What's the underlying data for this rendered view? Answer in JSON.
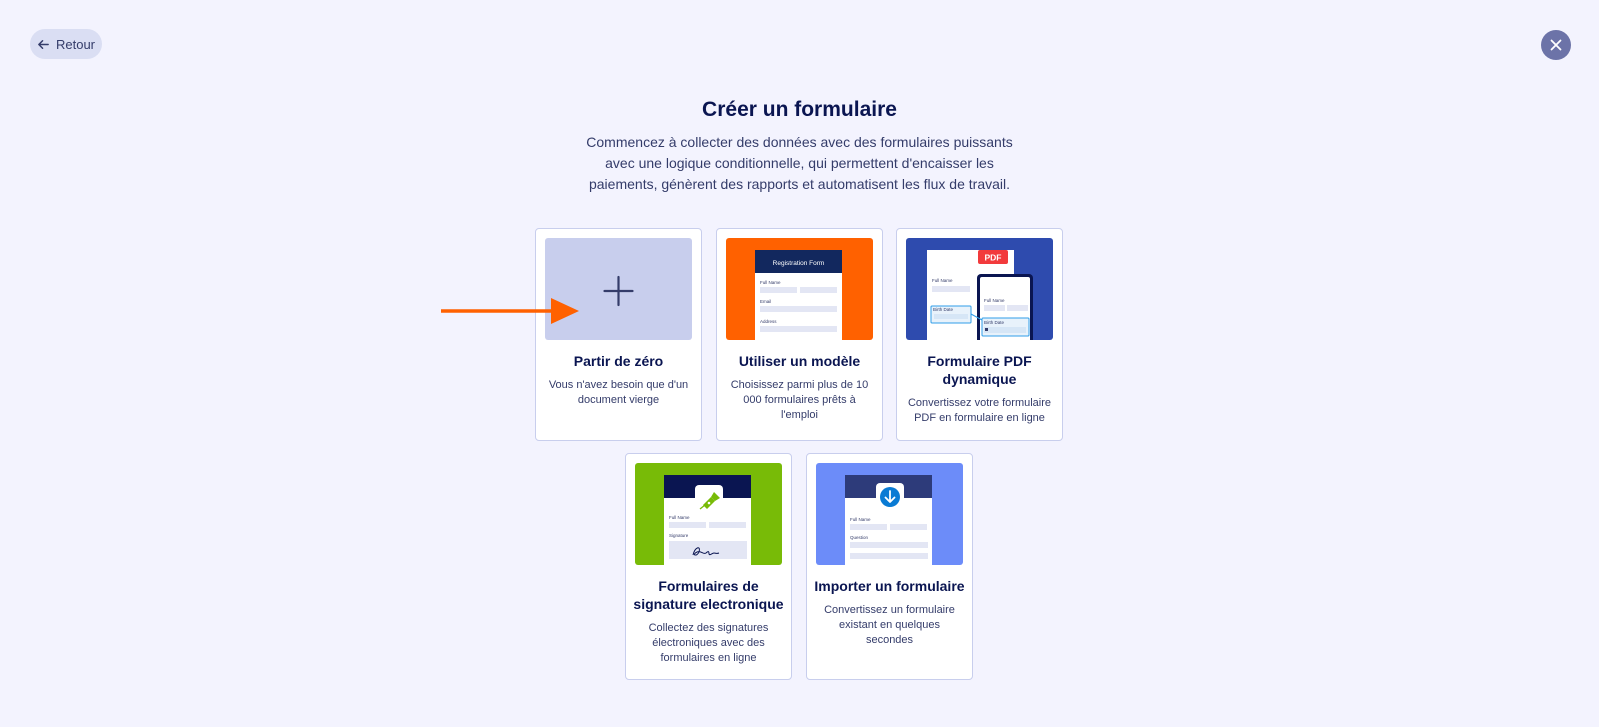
{
  "header": {
    "back_label": "Retour",
    "title": "Créer un formulaire",
    "subtitle": "Commencez à collecter des données avec des formulaires puissants avec une logique conditionnelle, qui permettent d'encaisser les paiements, génèrent des rapports et automatisent les flux de travail."
  },
  "cards": [
    {
      "title": "Partir de zéro",
      "description": "Vous n'avez besoin que d'un document vierge"
    },
    {
      "title": "Utiliser un modèle",
      "description": "Choisissez parmi plus de 10 000 formulaires prêts à l'emploi"
    },
    {
      "title": "Formulaire PDF dynamique",
      "description": "Convertissez votre formulaire PDF en formulaire en ligne"
    },
    {
      "title": "Formulaires de signature electronique",
      "description": "Collectez des signatures électroniques avec des formulaires en ligne"
    },
    {
      "title": "Importer un formulaire",
      "description": "Convertissez un formulaire existant en quelques secondes"
    }
  ],
  "thumbnails": {
    "template": {
      "form_title": "Registration Form",
      "labels": [
        "Full Name",
        "Email",
        "Address"
      ]
    },
    "pdf": {
      "badge": "PDF",
      "labels": [
        "Full Name",
        "Birth Date",
        "Full Name",
        "Birth Date"
      ]
    },
    "signature": {
      "labels": [
        "Full Name",
        "Signature"
      ]
    },
    "import": {
      "labels": [
        "Full Name",
        "Question"
      ]
    }
  },
  "colors": {
    "background": "#f3f3fe",
    "accent_orange": "#ff6100",
    "blank_thumb": "#c8ceed",
    "template_thumb": "#ff6100",
    "pdf_thumb": "#2e4bae",
    "signature_thumb": "#78bb07",
    "import_thumb": "#6c8cf9",
    "navy": "#0a1551"
  },
  "icons": [
    "arrow-left-icon",
    "close-icon",
    "plus-icon",
    "pen-nib-icon",
    "download-icon",
    "lock-icon",
    "orange-arrow-pointer"
  ]
}
